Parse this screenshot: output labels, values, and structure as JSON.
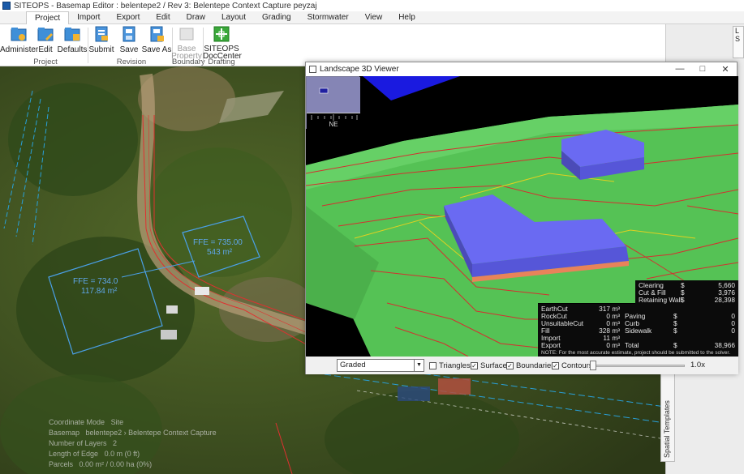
{
  "window": {
    "title": "SITEOPS - Basemap Editor : belentepe2 / Rev 3: Belentepe Context Capture peyzaj"
  },
  "menu_tabs": [
    "Project",
    "Import",
    "Export",
    "Edit",
    "Draw",
    "Layout",
    "Grading",
    "Stormwater",
    "View",
    "Help"
  ],
  "ribbon": {
    "buttons": [
      {
        "label": "Administer",
        "icon": "folder-gear-icon"
      },
      {
        "label": "Edit",
        "icon": "folder-edit-icon"
      },
      {
        "label": "Defaults",
        "icon": "folder-defaults-icon"
      },
      {
        "label": "Submit",
        "icon": "document-submit-icon"
      },
      {
        "label": "Save",
        "icon": "save-icon"
      },
      {
        "label": "Save As",
        "icon": "save-as-icon"
      },
      {
        "label": "Base Property",
        "icon": "base-property-icon"
      },
      {
        "label": "SITEOPS DocCenter",
        "icon": "doccenter-icon"
      }
    ],
    "groups": [
      "Project",
      "Revision",
      "Boundary",
      "Drafting"
    ],
    "right_button_label": "L S"
  },
  "map": {
    "fpe_labels": [
      {
        "line1": "FFE = 735.00",
        "line2": "543 m²"
      },
      {
        "line1": "FFE = 734.0",
        "line2": "117.84 m²"
      }
    ],
    "status_rows": [
      {
        "label": "Coordinate Mode",
        "value": "Site"
      },
      {
        "label": "Basemap",
        "value": "belentepe2 › Belentepe Context Capture"
      },
      {
        "label": "Number of Layers",
        "value": "2"
      },
      {
        "label": "Length of Edge",
        "value": "0.0 m (0 ft)"
      },
      {
        "label": "Parcels",
        "value": "0.00 m² / 0.00 ha (0%)"
      }
    ],
    "sidebar_tab": "Spatial Templates"
  },
  "viewer": {
    "title": "Landscape 3D Viewer",
    "compass_label": "NE",
    "costs": [
      {
        "label": "Clearing",
        "currency": "$",
        "value": "5,660"
      },
      {
        "label": "Cut & Fill",
        "currency": "$",
        "value": "3,976"
      },
      {
        "label": "Retaining Wall",
        "currency": "$",
        "value": "28,398"
      }
    ],
    "volumes": [
      {
        "label": "EarthCut",
        "value": "317 m³",
        "cost_label": "",
        "cost_currency": "",
        "cost_value": ""
      },
      {
        "label": "RockCut",
        "value": "0 m³",
        "cost_label": "Paving",
        "cost_currency": "$",
        "cost_value": "0"
      },
      {
        "label": "UnsuitableCut",
        "value": "0 m³",
        "cost_label": "Curb",
        "cost_currency": "$",
        "cost_value": "0"
      },
      {
        "label": "Fill",
        "value": "328 m³",
        "cost_label": "Sidewalk",
        "cost_currency": "$",
        "cost_value": "0"
      },
      {
        "label": "Import",
        "value": "11 m³",
        "cost_label": "",
        "cost_currency": "",
        "cost_value": ""
      },
      {
        "label": "Export",
        "value": "0 m³",
        "cost_label": "Total",
        "cost_currency": "$",
        "cost_value": "38,966"
      }
    ],
    "note": "NOTE: For the most accurate estimate, project should be submitted to the solver.",
    "mode": "Graded",
    "checkboxes": [
      {
        "label": "Triangles",
        "checked": false
      },
      {
        "label": "Surface",
        "checked": true
      },
      {
        "label": "Boundaries",
        "checked": true
      },
      {
        "label": "Contours",
        "checked": true
      }
    ],
    "zoom": "1.0x",
    "zoom_fraction": 0.0,
    "check_glyph": "✓"
  },
  "colors": {
    "terrain": "#55c255",
    "building": "#6464f0",
    "contour": "#d43030",
    "boundary": "#e0d020",
    "map_lines": "#29a0d8"
  }
}
